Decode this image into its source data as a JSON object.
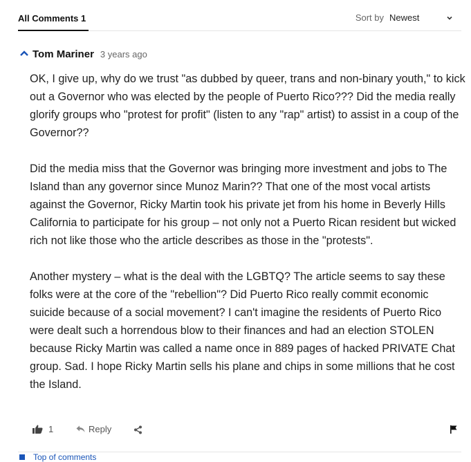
{
  "tabs": {
    "all_comments": "All Comments 1"
  },
  "sort": {
    "label": "Sort by",
    "value": "Newest"
  },
  "comment": {
    "author": "Tom Mariner",
    "time": "3 years ago",
    "paragraphs": [
      "OK, I give up, why do we trust \"as dubbed by queer, trans and non-binary youth,\" to kick out a Governor who was elected by the people of Puerto Rico??? Did the media really glorify groups who \"protest for profit\" (listen to any \"rap\" artist) to assist in a coup of the Governor??",
      "Did the media miss that the Governor was bringing more investment and jobs to The Island than any governor since Munoz Marin?? That one of the most vocal artists against the Governor, Ricky Martin took his private jet from his home in Beverly Hills California to participate for his group – not only not a Puerto Rican resident but wicked rich not like those who the article describes as those in the \"protests\".",
      "Another mystery – what is the deal with the LGBTQ? The article seems to say these folks were at the core of the \"rebellion\"? Did Puerto Rico really commit economic suicide because of a social movement? I can't imagine the residents of Puerto Rico were dealt such a horrendous blow to their finances and had an election STOLEN because Ricky Martin was called a name once in 889 pages of hacked PRIVATE Chat group. Sad. I hope Ricky Martin sells his plane and chips in some millions that he cost the Island."
    ],
    "likes": "1",
    "reply_label": "Reply"
  },
  "footer": {
    "top_link": "Top of comments"
  },
  "colors": {
    "accent_blue": "#1a55b8",
    "text": "#222222",
    "muted": "#666666"
  },
  "icons": [
    "chevron-down-icon",
    "chevron-up-icon",
    "thumbs-up-icon",
    "reply-arrow-icon",
    "share-icon",
    "flag-icon"
  ]
}
